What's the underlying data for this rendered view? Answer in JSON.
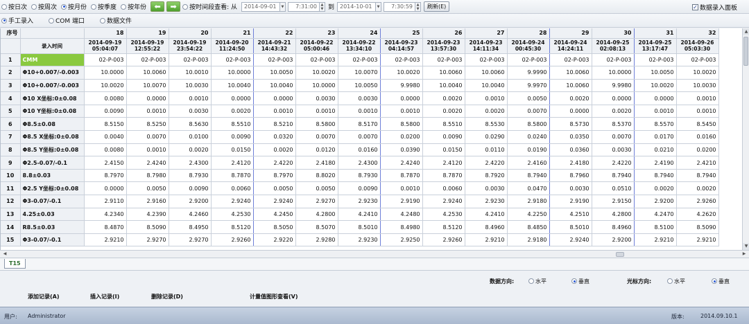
{
  "toolbar": {
    "radios": [
      {
        "label": "按日次",
        "selected": false
      },
      {
        "label": "按周次",
        "selected": false
      },
      {
        "label": "按月份",
        "selected": true
      },
      {
        "label": "按季度",
        "selected": false
      },
      {
        "label": "按年份",
        "selected": false
      }
    ],
    "prev_arrow": "⬅",
    "next_arrow": "➡",
    "time_range_radio": "按时间段查看: 从",
    "from_date": "2014-09-01",
    "from_time": "7:31:00",
    "to_label": "到",
    "to_date": "2014-10-01",
    "to_time": "7:30:59",
    "refresh_button": "刷新(E)",
    "entry_panel_check": "数据录入面板"
  },
  "input_mode": {
    "radios": [
      {
        "label": "手工录入",
        "selected": true
      },
      {
        "label": "COM 端口",
        "selected": false
      },
      {
        "label": "数据文件",
        "selected": false
      }
    ]
  },
  "grid": {
    "corner_label": "序号",
    "time_header": "录入时间",
    "columns": [
      {
        "num": "18",
        "date": "2014-09-19",
        "time": "05:04:07"
      },
      {
        "num": "19",
        "date": "2014-09-19",
        "time": "12:55:22"
      },
      {
        "num": "20",
        "date": "2014-09-19",
        "time": "23:54:22"
      },
      {
        "num": "21",
        "date": "2014-09-20",
        "time": "11:24:50"
      },
      {
        "num": "22",
        "date": "2014-09-21",
        "time": "14:43:32"
      },
      {
        "num": "23",
        "date": "2014-09-22",
        "time": "05:00:46"
      },
      {
        "num": "24",
        "date": "2014-09-22",
        "time": "13:34:10"
      },
      {
        "num": "25",
        "date": "2014-09-23",
        "time": "04:14:57"
      },
      {
        "num": "26",
        "date": "2014-09-23",
        "time": "13:57:30"
      },
      {
        "num": "27",
        "date": "2014-09-23",
        "time": "14:11:34"
      },
      {
        "num": "28",
        "date": "2014-09-24",
        "time": "00:45:30"
      },
      {
        "num": "29",
        "date": "2014-09-24",
        "time": "14:24:11"
      },
      {
        "num": "30",
        "date": "2014-09-25",
        "time": "02:08:13"
      },
      {
        "num": "31",
        "date": "2014-09-25",
        "time": "13:17:47"
      },
      {
        "num": "32",
        "date": "2014-09-26",
        "time": "05:03:30"
      }
    ],
    "rows": [
      {
        "idx": "1",
        "name": "CMM",
        "values": [
          "02-P-003",
          "02-P-003",
          "02-P-003",
          "02-P-003",
          "02-P-003",
          "02-P-003",
          "02-P-003",
          "02-P-003",
          "02-P-003",
          "02-P-003",
          "02-P-003",
          "02-P-003",
          "02-P-003",
          "02-P-003",
          "02-P-003"
        ]
      },
      {
        "idx": "2",
        "name": "Φ10+0.007/-0.003",
        "values": [
          "10.0000",
          "10.0060",
          "10.0010",
          "10.0000",
          "10.0050",
          "10.0020",
          "10.0070",
          "10.0020",
          "10.0060",
          "10.0060",
          "9.9990",
          "10.0060",
          "10.0000",
          "10.0050",
          "10.0020"
        ]
      },
      {
        "idx": "3",
        "name": "Φ10+0.007/-0.003",
        "values": [
          "10.0020",
          "10.0070",
          "10.0030",
          "10.0040",
          "10.0040",
          "10.0000",
          "10.0050",
          "9.9980",
          "10.0040",
          "10.0040",
          "9.9970",
          "10.0060",
          "9.9980",
          "10.0020",
          "10.0030"
        ]
      },
      {
        "idx": "4",
        "name": "Φ10 X坐标:0±0.08",
        "values": [
          "0.0080",
          "0.0000",
          "0.0010",
          "0.0000",
          "0.0000",
          "0.0030",
          "0.0030",
          "0.0000",
          "0.0020",
          "0.0010",
          "0.0050",
          "0.0020",
          "0.0000",
          "0.0000",
          "0.0010"
        ]
      },
      {
        "idx": "5",
        "name": "Φ10 Y坐标:0±0.08",
        "values": [
          "0.0090",
          "0.0010",
          "0.0030",
          "0.0020",
          "0.0010",
          "0.0010",
          "0.0010",
          "0.0010",
          "0.0020",
          "0.0020",
          "0.0070",
          "0.0000",
          "0.0020",
          "0.0010",
          "0.0010"
        ]
      },
      {
        "idx": "6",
        "name": "Φ8.5±0.08",
        "values": [
          "8.5150",
          "8.5250",
          "8.5630",
          "8.5510",
          "8.5210",
          "8.5800",
          "8.5170",
          "8.5800",
          "8.5510",
          "8.5530",
          "8.5800",
          "8.5730",
          "8.5370",
          "8.5570",
          "8.5450"
        ]
      },
      {
        "idx": "7",
        "name": "Φ8.5 X坐标:0±0.08",
        "values": [
          "0.0040",
          "0.0070",
          "0.0100",
          "0.0090",
          "0.0320",
          "0.0070",
          "0.0070",
          "0.0200",
          "0.0090",
          "0.0290",
          "0.0240",
          "0.0350",
          "0.0070",
          "0.0170",
          "0.0160"
        ]
      },
      {
        "idx": "8",
        "name": "Φ8.5 Y坐标:0±0.08",
        "values": [
          "0.0080",
          "0.0010",
          "0.0020",
          "0.0150",
          "0.0020",
          "0.0120",
          "0.0160",
          "0.0390",
          "0.0150",
          "0.0110",
          "0.0190",
          "0.0360",
          "0.0030",
          "0.0210",
          "0.0200"
        ]
      },
      {
        "idx": "9",
        "name": "Φ2.5-0.07/-0.1",
        "values": [
          "2.4150",
          "2.4240",
          "2.4300",
          "2.4120",
          "2.4220",
          "2.4180",
          "2.4300",
          "2.4240",
          "2.4120",
          "2.4220",
          "2.4160",
          "2.4180",
          "2.4220",
          "2.4190",
          "2.4210"
        ]
      },
      {
        "idx": "10",
        "name": "8.8±0.03",
        "values": [
          "8.7970",
          "8.7980",
          "8.7930",
          "8.7870",
          "8.7970",
          "8.8020",
          "8.7930",
          "8.7870",
          "8.7870",
          "8.7920",
          "8.7940",
          "8.7960",
          "8.7940",
          "8.7940",
          "8.7940"
        ]
      },
      {
        "idx": "11",
        "name": "Φ2.5 Y坐标:0±0.08",
        "values": [
          "0.0000",
          "0.0050",
          "0.0090",
          "0.0060",
          "0.0050",
          "0.0050",
          "0.0090",
          "0.0010",
          "0.0060",
          "0.0030",
          "0.0470",
          "0.0030",
          "0.0510",
          "0.0020",
          "0.0020"
        ]
      },
      {
        "idx": "12",
        "name": "Φ3-0.07/-0.1",
        "values": [
          "2.9110",
          "2.9160",
          "2.9200",
          "2.9240",
          "2.9240",
          "2.9270",
          "2.9230",
          "2.9190",
          "2.9240",
          "2.9230",
          "2.9180",
          "2.9190",
          "2.9150",
          "2.9200",
          "2.9260"
        ]
      },
      {
        "idx": "13",
        "name": "4.25±0.03",
        "values": [
          "4.2340",
          "4.2390",
          "4.2460",
          "4.2530",
          "4.2450",
          "4.2800",
          "4.2410",
          "4.2480",
          "4.2530",
          "4.2410",
          "4.2250",
          "4.2510",
          "4.2800",
          "4.2470",
          "4.2620"
        ]
      },
      {
        "idx": "14",
        "name": "R8.5±0.03",
        "values": [
          "8.4870",
          "8.5090",
          "8.4950",
          "8.5120",
          "8.5050",
          "8.5070",
          "8.5010",
          "8.4980",
          "8.5120",
          "8.4960",
          "8.4850",
          "8.5010",
          "8.4960",
          "8.5100",
          "8.5090"
        ]
      },
      {
        "idx": "15",
        "name": "Φ3-0.07/-0.1",
        "values": [
          "2.9210",
          "2.9270",
          "2.9270",
          "2.9260",
          "2.9220",
          "2.9280",
          "2.9230",
          "2.9250",
          "2.9260",
          "2.9210",
          "2.9180",
          "2.9240",
          "2.9200",
          "2.9210",
          "2.9210"
        ]
      }
    ]
  },
  "sheet_tab": "T15",
  "options": {
    "data_direction_label": "数据方向:",
    "cursor_direction_label": "光标方向:",
    "horizontal": "水平",
    "vertical": "垂直"
  },
  "actions": {
    "add": "添加记录(A)",
    "insert": "插入记录(I)",
    "delete": "删除记录(D)",
    "chart": "计量值图形查看(V)"
  },
  "status": {
    "user_label": "用户:",
    "user_name": "Administrator",
    "version_label": "版本:",
    "version": "2014.09.10.1"
  }
}
